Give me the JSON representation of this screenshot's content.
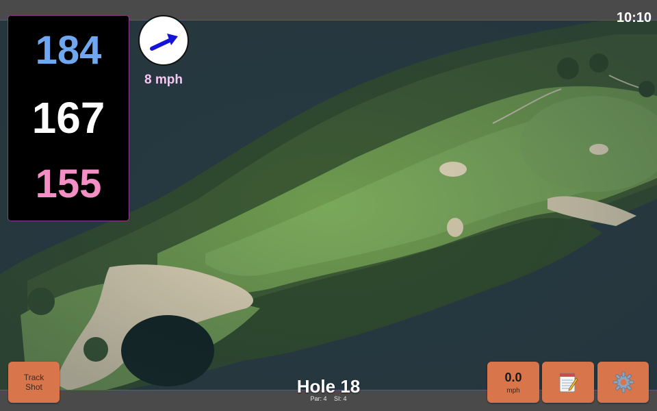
{
  "status": {
    "time": "10:10"
  },
  "distances": {
    "back": "184",
    "middle": "167",
    "front": "155"
  },
  "wind": {
    "speed": "8 mph",
    "icon": "wind-arrow-icon"
  },
  "hole": {
    "title": "Hole 18",
    "par": "Par: 4",
    "stroke_index": "SI: 4"
  },
  "buttons": {
    "track_shot": "Track Shot",
    "speed_value": "0.0",
    "speed_unit": "mph",
    "notes_icon": "notepad-icon",
    "settings_icon": "gear-icon"
  },
  "colors": {
    "back": "#6fa8f0",
    "middle": "#ffffff",
    "front": "#f48fc5",
    "button": "#d9754a",
    "accent_border": "#8a3d8a"
  }
}
